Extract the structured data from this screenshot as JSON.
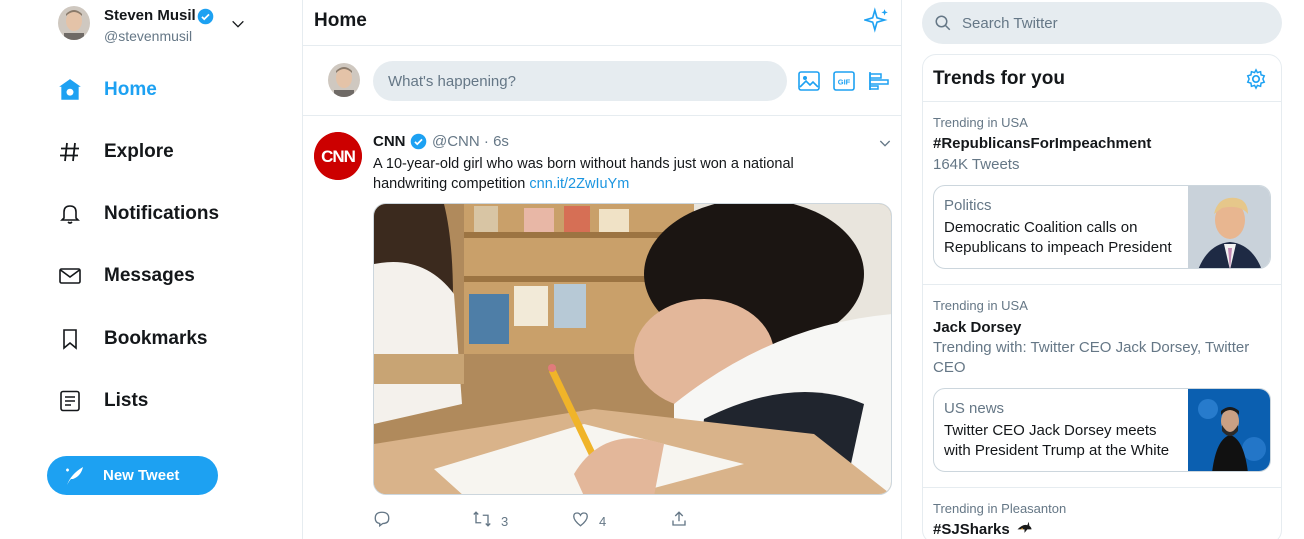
{
  "account": {
    "name": "Steven Musil",
    "handle": "@stevenmusil"
  },
  "nav": {
    "items": [
      {
        "label": "Home",
        "icon": "home-icon"
      },
      {
        "label": "Explore",
        "icon": "hashtag-icon"
      },
      {
        "label": "Notifications",
        "icon": "bell-icon"
      },
      {
        "label": "Messages",
        "icon": "envelope-icon"
      },
      {
        "label": "Bookmarks",
        "icon": "bookmark-icon"
      },
      {
        "label": "Lists",
        "icon": "list-icon"
      }
    ],
    "new_tweet_label": "New Tweet"
  },
  "header": {
    "title": "Home"
  },
  "compose": {
    "placeholder": "What's happening?"
  },
  "tweet": {
    "name": "CNN",
    "handle": "@CNN",
    "time": "6s",
    "separator": "·",
    "text": "A 10-year-old girl who was born without hands just won a national handwriting competition ",
    "link": "cnn.it/2ZwIuYm",
    "logo_text": "CNN",
    "retweets": "3",
    "likes": "4"
  },
  "search": {
    "placeholder": "Search Twitter"
  },
  "trends": {
    "title": "Trends for you",
    "items": [
      {
        "context": "Trending in USA",
        "name": "#RepublicansForImpeachment",
        "detail": "164K Tweets",
        "card": {
          "category": "Politics",
          "headline": "Democratic Coalition calls on Republicans to impeach President"
        }
      },
      {
        "context": "Trending in USA",
        "name": "Jack Dorsey",
        "detail": "Trending with: Twitter CEO Jack Dorsey, Twitter CEO",
        "card": {
          "category": "US news",
          "headline": "Twitter CEO Jack Dorsey meets with President Trump at the White"
        }
      },
      {
        "context": "Trending in Pleasanton",
        "name": "#SJSharks"
      }
    ]
  },
  "colors": {
    "accent": "#1da1f2",
    "text": "#14171a",
    "muted": "#657786",
    "border": "#e6ecf0",
    "cnn_red": "#cc0000"
  }
}
